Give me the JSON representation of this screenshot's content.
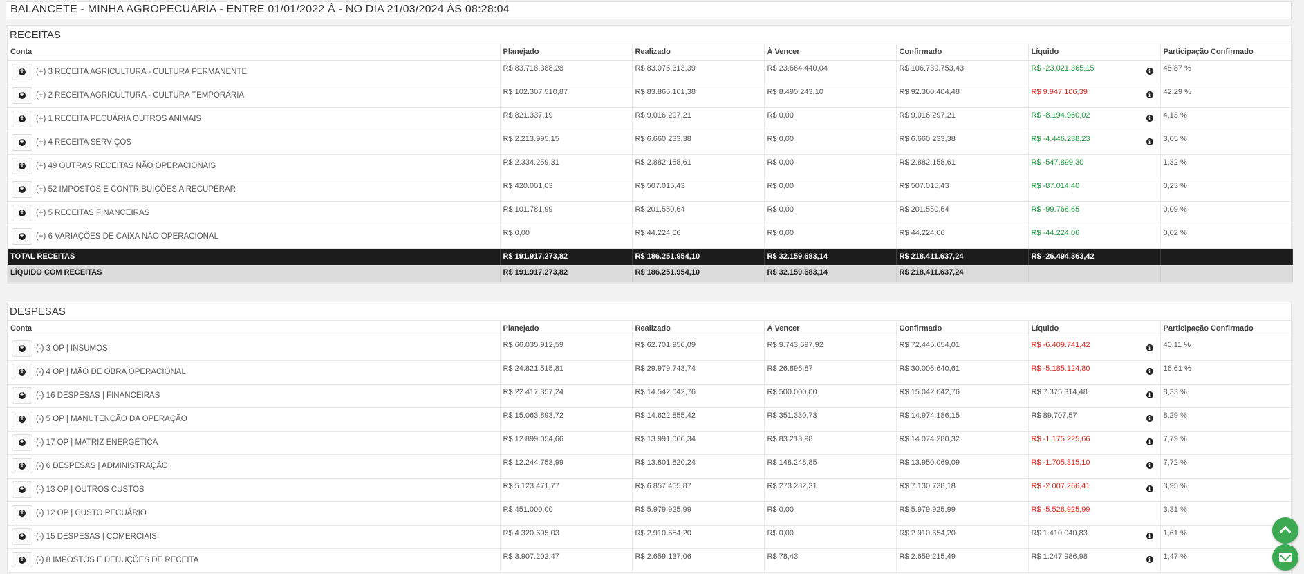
{
  "title": "BALANCETE - MINHA AGROPECUÁRIA - ENTRE 01/01/2022 À - NO DIA 21/03/2024 ÀS 08:28:04",
  "headers": [
    "Conta",
    "Planejado",
    "Realizado",
    "À Vencer",
    "Confirmado",
    "Líquido",
    "Participação Confirmado"
  ],
  "colors": {
    "positive": "#1a9b3d",
    "negative": "#e0261b",
    "total_bg": "#1c1c1c",
    "fab": "#3caa52"
  },
  "receitas": {
    "title": "RECEITAS",
    "rows": [
      {
        "conta": "(+) 3 RECEITA AGRICULTURA - CULTURA PERMANENTE",
        "planejado": "R$ 83.718.388,28",
        "realizado": "R$ 83.075.313,39",
        "a_vencer": "R$ 23.664.440,04",
        "confirmado": "R$ 106.739.753,43",
        "liquido": "R$ -23.021.365,15",
        "liquido_tone": "pos",
        "info": true,
        "participacao": "48,87 %"
      },
      {
        "conta": "(+) 2 RECEITA AGRICULTURA - CULTURA TEMPORÁRIA",
        "planejado": "R$ 102.307.510,87",
        "realizado": "R$ 83.865.161,38",
        "a_vencer": "R$ 8.495.243,10",
        "confirmado": "R$ 92.360.404,48",
        "liquido": "R$ 9.947.106,39",
        "liquido_tone": "neg",
        "info": true,
        "participacao": "42,29 %"
      },
      {
        "conta": "(+) 1 RECEITA PECUÁRIA OUTROS ANIMAIS",
        "planejado": "R$ 821.337,19",
        "realizado": "R$ 9.016.297,21",
        "a_vencer": "R$ 0,00",
        "confirmado": "R$ 9.016.297,21",
        "liquido": "R$ -8.194.960,02",
        "liquido_tone": "pos",
        "info": true,
        "participacao": "4,13 %"
      },
      {
        "conta": "(+) 4 RECEITA SERVIÇOS",
        "planejado": "R$ 2.213.995,15",
        "realizado": "R$ 6.660.233,38",
        "a_vencer": "R$ 0,00",
        "confirmado": "R$ 6.660.233,38",
        "liquido": "R$ -4.446.238,23",
        "liquido_tone": "pos",
        "info": true,
        "participacao": "3,05 %"
      },
      {
        "conta": "(+) 49 OUTRAS RECEITAS NÃO OPERACIONAIS",
        "planejado": "R$ 2.334.259,31",
        "realizado": "R$ 2.882.158,61",
        "a_vencer": "R$ 0,00",
        "confirmado": "R$ 2.882.158,61",
        "liquido": "R$ -547.899,30",
        "liquido_tone": "pos",
        "info": false,
        "participacao": "1,32 %"
      },
      {
        "conta": "(+) 52 IMPOSTOS E CONTRIBUIÇÕES A RECUPERAR",
        "planejado": "R$ 420.001,03",
        "realizado": "R$ 507.015,43",
        "a_vencer": "R$ 0,00",
        "confirmado": "R$ 507.015,43",
        "liquido": "R$ -87.014,40",
        "liquido_tone": "pos",
        "info": false,
        "participacao": "0,23 %"
      },
      {
        "conta": "(+) 5 RECEITAS FINANCEIRAS",
        "planejado": "R$ 101.781,99",
        "realizado": "R$ 201.550,64",
        "a_vencer": "R$ 0,00",
        "confirmado": "R$ 201.550,64",
        "liquido": "R$ -99.768,65",
        "liquido_tone": "pos",
        "info": false,
        "participacao": "0,09 %"
      },
      {
        "conta": "(+) 6 VARIAÇÕES DE CAIXA NÃO OPERACIONAL",
        "planejado": "R$ 0,00",
        "realizado": "R$ 44.224,06",
        "a_vencer": "R$ 0,00",
        "confirmado": "R$ 44.224,06",
        "liquido": "R$ -44.224,06",
        "liquido_tone": "pos",
        "info": false,
        "participacao": "0,02 %"
      }
    ],
    "total": {
      "label": "TOTAL RECEITAS",
      "planejado": "R$ 191.917.273,82",
      "realizado": "R$ 186.251.954,10",
      "a_vencer": "R$ 32.159.683,14",
      "confirmado": "R$ 218.411.637,24",
      "liquido": "R$ -26.494.363,42",
      "participacao": ""
    },
    "liquido_row": {
      "label": "LÍQUIDO COM RECEITAS",
      "planejado": "R$ 191.917.273,82",
      "realizado": "R$ 186.251.954,10",
      "a_vencer": "R$ 32.159.683,14",
      "confirmado": "R$ 218.411.637,24",
      "liquido": "",
      "participacao": ""
    }
  },
  "despesas": {
    "title": "DESPESAS",
    "rows": [
      {
        "conta": "(-) 3 OP | INSUMOS",
        "planejado": "R$ 66.035.912,59",
        "realizado": "R$ 62.701.956,09",
        "a_vencer": "R$ 9.743.697,92",
        "confirmado": "R$ 72.445.654,01",
        "liquido": "R$ -6.409.741,42",
        "liquido_tone": "neg",
        "info": true,
        "participacao": "40,11 %"
      },
      {
        "conta": "(-) 4 OP | MÃO DE OBRA OPERACIONAL",
        "planejado": "R$ 24.821.515,81",
        "realizado": "R$ 29.979.743,74",
        "a_vencer": "R$ 26.896,87",
        "confirmado": "R$ 30.006.640,61",
        "liquido": "R$ -5.185.124,80",
        "liquido_tone": "neg",
        "info": true,
        "participacao": "16,61 %"
      },
      {
        "conta": "(-) 16 DESPESAS | FINANCEIRAS",
        "planejado": "R$ 22.417.357,24",
        "realizado": "R$ 14.542.042,76",
        "a_vencer": "R$ 500.000,00",
        "confirmado": "R$ 15.042.042,76",
        "liquido": "R$ 7.375.314,48",
        "liquido_tone": "plain",
        "info": true,
        "participacao": "8,33 %"
      },
      {
        "conta": "(-) 5 OP | MANUTENÇÃO DA OPERAÇÃO",
        "planejado": "R$ 15.063.893,72",
        "realizado": "R$ 14.622.855,42",
        "a_vencer": "R$ 351.330,73",
        "confirmado": "R$ 14.974.186,15",
        "liquido": "R$ 89.707,57",
        "liquido_tone": "plain",
        "info": true,
        "participacao": "8,29 %"
      },
      {
        "conta": "(-) 17 OP | MATRIZ ENERGÉTICA",
        "planejado": "R$ 12.899.054,66",
        "realizado": "R$ 13.991.066,34",
        "a_vencer": "R$ 83.213,98",
        "confirmado": "R$ 14.074.280,32",
        "liquido": "R$ -1.175.225,66",
        "liquido_tone": "neg",
        "info": true,
        "participacao": "7,79 %"
      },
      {
        "conta": "(-) 6 DESPESAS | ADMINISTRAÇÃO",
        "planejado": "R$ 12.244.753,99",
        "realizado": "R$ 13.801.820,24",
        "a_vencer": "R$ 148.248,85",
        "confirmado": "R$ 13.950.069,09",
        "liquido": "R$ -1.705.315,10",
        "liquido_tone": "neg",
        "info": true,
        "participacao": "7,72 %"
      },
      {
        "conta": "(-) 13 OP | OUTROS CUSTOS",
        "planejado": "R$ 5.123.471,77",
        "realizado": "R$ 6.857.455,87",
        "a_vencer": "R$ 273.282,31",
        "confirmado": "R$ 7.130.738,18",
        "liquido": "R$ -2.007.266,41",
        "liquido_tone": "neg",
        "info": true,
        "participacao": "3,95 %"
      },
      {
        "conta": "(-) 12 OP | CUSTO PECUÁRIO",
        "planejado": "R$ 451.000,00",
        "realizado": "R$ 5.979.925,99",
        "a_vencer": "R$ 0,00",
        "confirmado": "R$ 5.979.925,99",
        "liquido": "R$ -5.528.925,99",
        "liquido_tone": "neg",
        "info": false,
        "participacao": "3,31 %"
      },
      {
        "conta": "(-) 15 DESPESAS | COMERCIAIS",
        "planejado": "R$ 4.320.695,03",
        "realizado": "R$ 2.910.654,20",
        "a_vencer": "R$ 0,00",
        "confirmado": "R$ 2.910.654,20",
        "liquido": "R$ 1.410.040,83",
        "liquido_tone": "plain",
        "info": true,
        "participacao": "1,61 %"
      },
      {
        "conta": "(-) 8 IMPOSTOS E DEDUÇÕES DE RECEITA",
        "planejado": "R$ 3.907.202,47",
        "realizado": "R$ 2.659.137,06",
        "a_vencer": "R$ 78,43",
        "confirmado": "R$ 2.659.215,49",
        "liquido": "R$ 1.247.986,98",
        "liquido_tone": "plain",
        "info": true,
        "participacao": "1,47 %"
      }
    ]
  },
  "fabs": {
    "up_icon": "chevron-up-icon",
    "mail_icon": "mail-icon"
  }
}
